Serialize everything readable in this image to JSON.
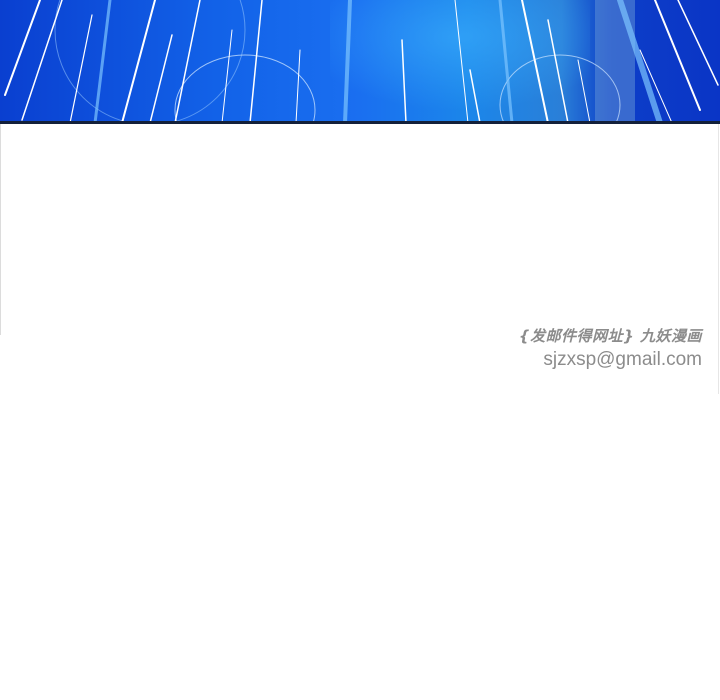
{
  "panel": {
    "description_colors": {
      "primary_blue": "#1262e8",
      "deep_blue": "#0a35c6",
      "highlight": "#ffffff"
    }
  },
  "watermark": {
    "line1": "{发邮件得网址} 九妖漫画",
    "line2": "sjzxsp@gmail.com"
  }
}
